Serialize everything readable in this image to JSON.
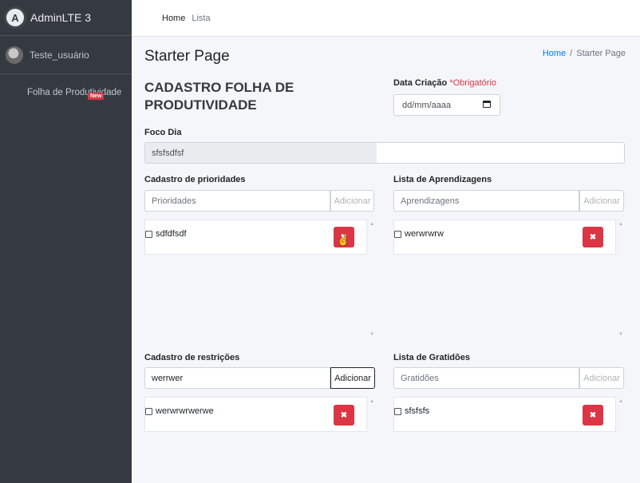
{
  "sidebar": {
    "brand": "AdminLTE 3",
    "brand_logo": "A",
    "user_name": "Teste_usuário",
    "nav_item_label": "Folha de Produtividade",
    "nav_item_badge": "New"
  },
  "topnav": {
    "home": "Home",
    "lista": "Lista"
  },
  "header": {
    "title": "Starter Page",
    "breadcrumb_home": "Home",
    "breadcrumb_sep": "/",
    "breadcrumb_current": "Starter Page"
  },
  "form": {
    "title": "CADASTRO FOLHA DE PRODUTIVIDADE",
    "date_label": "Data Criação",
    "date_required": "*Obrigatório",
    "date_placeholder": "dd/mm/aaaa",
    "foco_label": "Foco Dia",
    "foco_value": "sfsfsdfsf"
  },
  "prioridades": {
    "label": "Cadastro de prioridades",
    "placeholder": "Prioridades",
    "button": "Adicionar",
    "items": [
      "sdfdfsdf"
    ]
  },
  "aprendizagens": {
    "label": "Lista de Aprendizagens",
    "placeholder": "Aprendizagens",
    "button": "Adicionar",
    "items": [
      "werwrwrw"
    ]
  },
  "restricoes": {
    "label": "Cadastro de restrições",
    "value": "werrwer",
    "button": "Adicionar",
    "items": [
      "werwrwrwerwe"
    ]
  },
  "gratidoes": {
    "label": "Lista de Gratidões",
    "placeholder": "Gratidões",
    "button": "Adicionar",
    "items": [
      "sfsfsfs"
    ]
  },
  "icons": {
    "delete": "✖",
    "scroll_up": "▲",
    "scroll_down": "▼"
  },
  "colors": {
    "sidebar": "#343a40",
    "danger": "#dc3545",
    "link": "#007bff"
  }
}
